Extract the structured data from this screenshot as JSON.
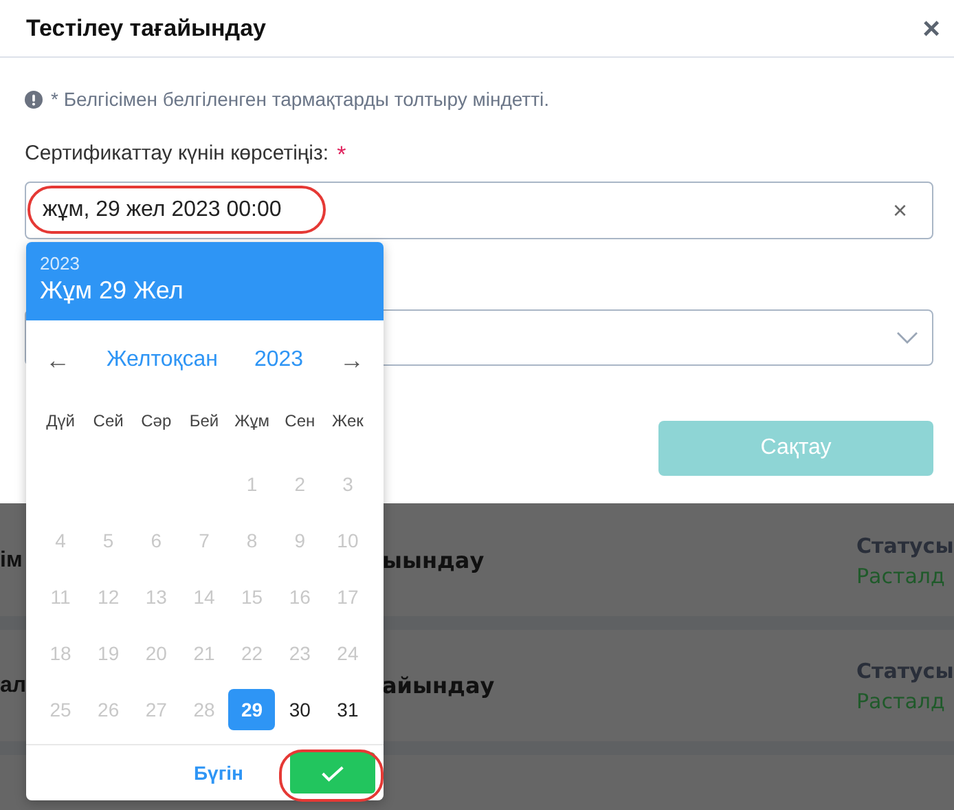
{
  "dialog": {
    "title": "Тестілеу тағайындау",
    "close": "×",
    "notice": "* Белгісімен белгіленген тармақтарды толтыру міндетті.",
    "date_label": "Сертификаттау күнін көрсетіңіз:",
    "required_mark": "*",
    "date_value": "жұм, 29 жел 2023 00:00",
    "clear": "×",
    "save": "Сақтау",
    "save_disabled": true
  },
  "datepicker": {
    "year": "2023",
    "date": "Жұм 29 Жел",
    "month": "Желтоқсан",
    "nav_year": "2023",
    "prev": "←",
    "next": "→",
    "weekdays": [
      "Дүй",
      "Сей",
      "Сәр",
      "Бей",
      "Жұм",
      "Сен",
      "Жек"
    ],
    "weeks": [
      [
        {
          "day": "1",
          "disabled": true,
          "selected": false
        },
        {
          "day": "2",
          "disabled": true,
          "selected": false
        },
        {
          "day": "3",
          "disabled": true,
          "selected": false
        }
      ],
      [
        {
          "day": "4",
          "disabled": true,
          "selected": false
        },
        {
          "day": "5",
          "disabled": true,
          "selected": false
        },
        {
          "day": "6",
          "disabled": true,
          "selected": false
        },
        {
          "day": "7",
          "disabled": true,
          "selected": false
        },
        {
          "day": "8",
          "disabled": true,
          "selected": false
        },
        {
          "day": "9",
          "disabled": true,
          "selected": false
        },
        {
          "day": "10",
          "disabled": true,
          "selected": false
        }
      ],
      [
        {
          "day": "11",
          "disabled": true,
          "selected": false
        },
        {
          "day": "12",
          "disabled": true,
          "selected": false
        },
        {
          "day": "13",
          "disabled": true,
          "selected": false
        },
        {
          "day": "14",
          "disabled": true,
          "selected": false
        },
        {
          "day": "15",
          "disabled": true,
          "selected": false
        },
        {
          "day": "16",
          "disabled": true,
          "selected": false
        },
        {
          "day": "17",
          "disabled": true,
          "selected": false
        }
      ],
      [
        {
          "day": "18",
          "disabled": true,
          "selected": false
        },
        {
          "day": "19",
          "disabled": true,
          "selected": false
        },
        {
          "day": "20",
          "disabled": true,
          "selected": false
        },
        {
          "day": "21",
          "disabled": true,
          "selected": false
        },
        {
          "day": "22",
          "disabled": true,
          "selected": false
        },
        {
          "day": "23",
          "disabled": true,
          "selected": false
        },
        {
          "day": "24",
          "disabled": true,
          "selected": false
        }
      ],
      [
        {
          "day": "25",
          "disabled": true,
          "selected": false
        },
        {
          "day": "26",
          "disabled": true,
          "selected": false
        },
        {
          "day": "27",
          "disabled": true,
          "selected": false
        },
        {
          "day": "28",
          "disabled": true,
          "selected": false
        },
        {
          "day": "29",
          "disabled": false,
          "selected": true
        },
        {
          "day": "30",
          "disabled": false,
          "selected": false
        },
        {
          "day": "31",
          "disabled": false,
          "selected": false
        }
      ]
    ],
    "today": "Бүгін"
  },
  "background_rows": [
    {
      "title_start": "ім",
      "title_end": "ыындау",
      "status_label": "Статусы",
      "status": "Расталд"
    },
    {
      "title_start": "ал",
      "title_end": "айындау",
      "status_label": "Статусы",
      "status": "Расталд"
    }
  ]
}
